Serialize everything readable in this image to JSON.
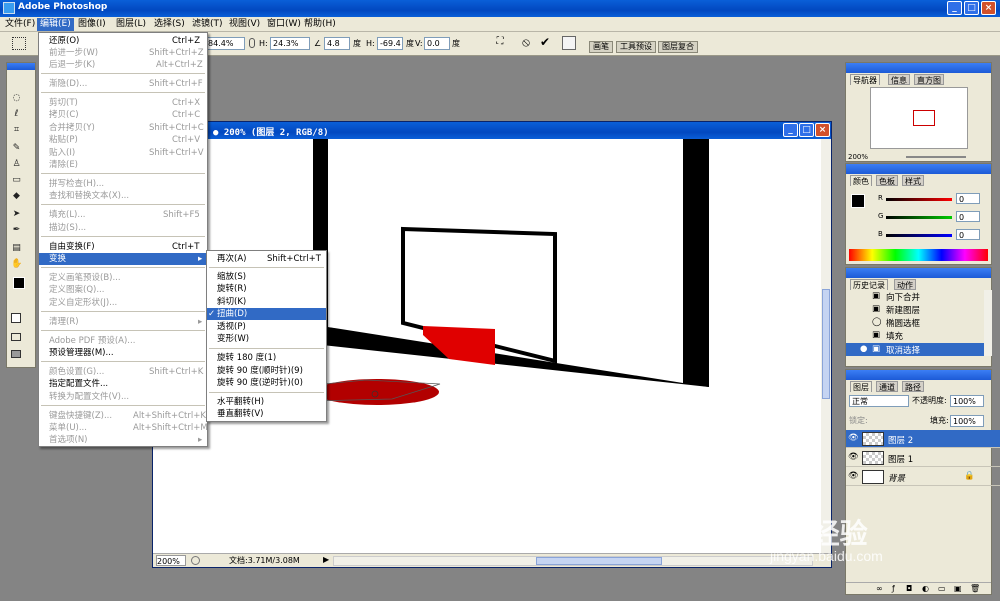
{
  "app": {
    "title": "Adobe Photoshop"
  },
  "menubar": [
    "文件(F)",
    "编辑(E)",
    "图像(I)",
    "图层(L)",
    "选择(S)",
    "滤镜(T)",
    "视图(V)",
    "窗口(W)",
    "帮助(H)"
  ],
  "options": {
    "w": "84.4%",
    "h_label": "H:",
    "h": "24.3%",
    "angle": "4.8",
    "angle_unit": "度",
    "hskew_label": "H:",
    "hskew": "-69.4",
    "hskew_unit": "度",
    "vskew_label": "V:",
    "vskew": "0.0",
    "vskew_unit": "度",
    "palette_tabs": [
      "画笔",
      "工具预设",
      "图层复合"
    ]
  },
  "document": {
    "title": "200% (图层 2, RGB/8)",
    "zoom": "200%",
    "doc_info": "文档:3.71M/3.08M"
  },
  "edit_menu": {
    "items": [
      {
        "label": "还原(O)",
        "shortcut": "Ctrl+Z",
        "disabled": false
      },
      {
        "label": "前进一步(W)",
        "shortcut": "Shift+Ctrl+Z",
        "disabled": true
      },
      {
        "label": "后退一步(K)",
        "shortcut": "Alt+Ctrl+Z",
        "disabled": true
      },
      {
        "label": "渐隐(D)...",
        "shortcut": "Shift+Ctrl+F",
        "disabled": true
      },
      {
        "label": "剪切(T)",
        "shortcut": "Ctrl+X",
        "disabled": true
      },
      {
        "label": "拷贝(C)",
        "shortcut": "Ctrl+C",
        "disabled": true
      },
      {
        "label": "合并拷贝(Y)",
        "shortcut": "Shift+Ctrl+C",
        "disabled": true
      },
      {
        "label": "粘贴(P)",
        "shortcut": "Ctrl+V",
        "disabled": true
      },
      {
        "label": "贴入(I)",
        "shortcut": "Shift+Ctrl+V",
        "disabled": true
      },
      {
        "label": "清除(E)",
        "shortcut": "",
        "disabled": true
      },
      {
        "label": "拼写检查(H)...",
        "shortcut": "",
        "disabled": true
      },
      {
        "label": "查找和替换文本(X)...",
        "shortcut": "",
        "disabled": true
      },
      {
        "label": "填充(L)...",
        "shortcut": "Shift+F5",
        "disabled": true
      },
      {
        "label": "描边(S)...",
        "shortcut": "",
        "disabled": true
      },
      {
        "label": "自由变换(F)",
        "shortcut": "Ctrl+T",
        "disabled": false
      },
      {
        "label": "变换",
        "shortcut": "",
        "disabled": false
      },
      {
        "label": "定义画笔预设(B)...",
        "shortcut": "",
        "disabled": true
      },
      {
        "label": "定义图案(Q)...",
        "shortcut": "",
        "disabled": true
      },
      {
        "label": "定义自定形状(J)...",
        "shortcut": "",
        "disabled": true
      },
      {
        "label": "清理(R)",
        "shortcut": "",
        "disabled": true
      },
      {
        "label": "Adobe PDF 预设(A)...",
        "shortcut": "",
        "disabled": true
      },
      {
        "label": "预设管理器(M)...",
        "shortcut": "",
        "disabled": false
      },
      {
        "label": "颜色设置(G)...",
        "shortcut": "Shift+Ctrl+K",
        "disabled": true
      },
      {
        "label": "指定配置文件...",
        "shortcut": "",
        "disabled": false
      },
      {
        "label": "转换为配置文件(V)...",
        "shortcut": "",
        "disabled": true
      },
      {
        "label": "键盘快捷键(Z)...",
        "shortcut": "Alt+Shift+Ctrl+K",
        "disabled": true
      },
      {
        "label": "菜单(U)...",
        "shortcut": "Alt+Shift+Ctrl+M",
        "disabled": true
      },
      {
        "label": "首选项(N)",
        "shortcut": "",
        "disabled": true
      }
    ]
  },
  "transform_menu": {
    "items": [
      {
        "label": "再次(A)",
        "shortcut": "Shift+Ctrl+T"
      },
      {
        "label": "缩放(S)",
        "shortcut": ""
      },
      {
        "label": "旋转(R)",
        "shortcut": ""
      },
      {
        "label": "斜切(K)",
        "shortcut": ""
      },
      {
        "label": "扭曲(D)",
        "shortcut": ""
      },
      {
        "label": "透视(P)",
        "shortcut": ""
      },
      {
        "label": "变形(W)",
        "shortcut": ""
      },
      {
        "label": "旋转 180 度(1)",
        "shortcut": ""
      },
      {
        "label": "旋转 90 度(顺时针)(9)",
        "shortcut": ""
      },
      {
        "label": "旋转 90 度(逆时针)(0)",
        "shortcut": ""
      },
      {
        "label": "水平翻转(H)",
        "shortcut": ""
      },
      {
        "label": "垂直翻转(V)",
        "shortcut": ""
      }
    ],
    "checkmark": "✓"
  },
  "navigator": {
    "tabs": [
      "导航器",
      "信息",
      "直方图"
    ],
    "zoom": "200%"
  },
  "color_panel": {
    "tabs": [
      "颜色",
      "色板",
      "样式"
    ],
    "channels": [
      "R",
      "G",
      "B"
    ],
    "values": [
      "0",
      "0",
      "0"
    ]
  },
  "history": {
    "tabs": [
      "历史记录",
      "动作"
    ],
    "items": [
      "向下合并",
      "新建图层",
      "椭圆选框",
      "填充",
      "取消选择"
    ]
  },
  "layers": {
    "tabs": [
      "图层",
      "通道",
      "路径"
    ],
    "blend_mode": "正常",
    "opacity_label": "不透明度:",
    "opacity": "100%",
    "lock_label": "锁定:",
    "fill_label": "填充:",
    "fill": "100%",
    "items": [
      "图层 2",
      "图层 1",
      "背景"
    ]
  },
  "watermark": {
    "text": "Bai经验",
    "url": "jingyan.baidu.com"
  }
}
